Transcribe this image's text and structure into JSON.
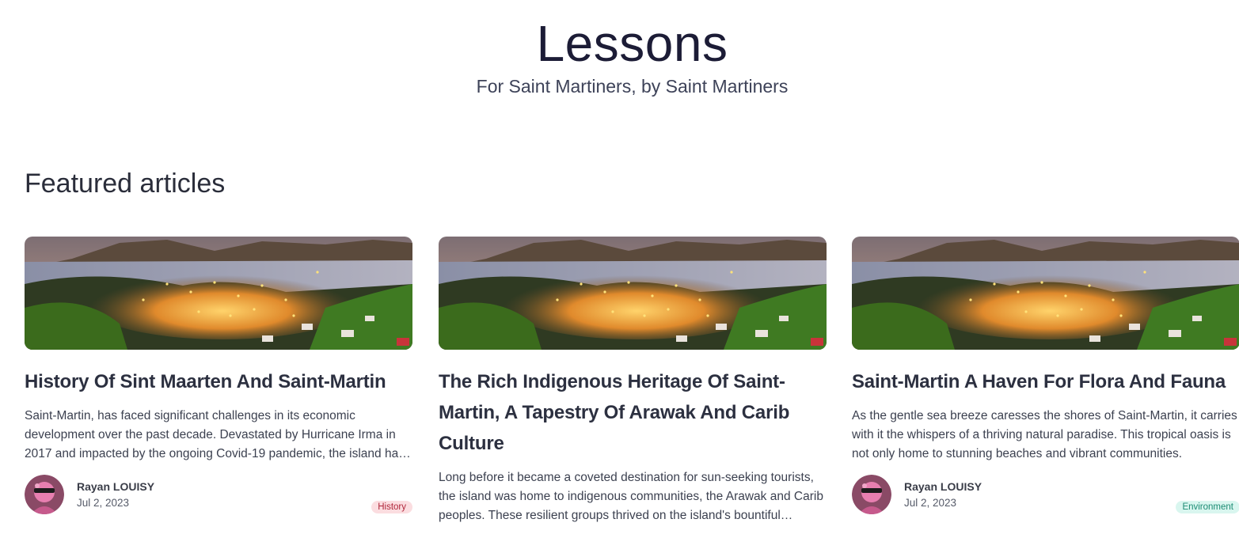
{
  "hero": {
    "title": "Lessons",
    "subtitle": "For Saint Martiners, by Saint Martiners"
  },
  "section": {
    "title": "Featured articles"
  },
  "articles": [
    {
      "title": "History Of Sint Maarten And Saint-Martin",
      "excerpt": "Saint-Martin, has faced significant challenges in its economic development over the past decade. Devastated by Hurricane Irma in 2017 and impacted by the ongoing Covid-19 pandemic, the island has struggled to find its footing.",
      "author": "Rayan LOUISY",
      "date": "Jul 2, 2023",
      "tag": "History",
      "tag_color": "#fbdde0",
      "image_icon": "island-bay-photo"
    },
    {
      "title": "The Rich Indigenous Heritage Of Saint-Martin, A Tapestry Of Arawak And Carib Culture",
      "excerpt": "Long before it became a coveted destination for sun-seeking tourists, the island was home to indigenous communities, the Arawak and Carib peoples. These resilient groups thrived on the island's bountiful resources.",
      "image_icon": "island-bay-photo"
    },
    {
      "title": "Saint-Martin A Haven For Flora And Fauna",
      "excerpt": "As the gentle sea breeze caresses the shores of Saint-Martin, it carries with it the whispers of a thriving natural paradise. This tropical oasis is not only home to stunning beaches and vibrant communities.",
      "author": "Rayan LOUISY",
      "date": "Jul 2, 2023",
      "tag": "Environment",
      "tag_color": "#d9f6ef",
      "image_icon": "island-bay-photo"
    }
  ]
}
